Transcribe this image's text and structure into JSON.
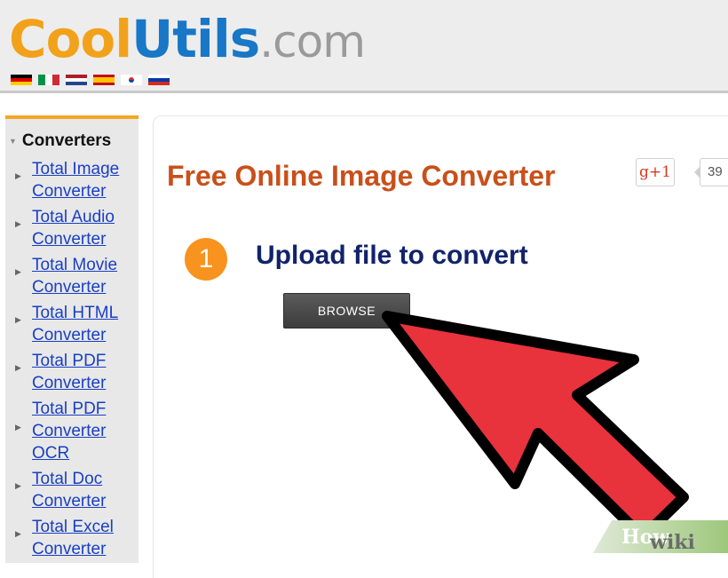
{
  "header": {
    "logo": {
      "part1": "Cool",
      "part2": "Utils",
      "part3": ".com"
    },
    "flags": [
      "german-flag",
      "italian-flag",
      "dutch-flag",
      "spanish-flag",
      "korean-flag",
      "russian-flag"
    ]
  },
  "sidebar": {
    "title": "Converters",
    "items": [
      {
        "label": "Total Image Converter"
      },
      {
        "label": "Total Audio Converter"
      },
      {
        "label": "Total Movie Converter"
      },
      {
        "label": "Total HTML Converter"
      },
      {
        "label": "Total PDF Converter"
      },
      {
        "label": "Total PDF Converter OCR"
      },
      {
        "label": "Total Doc Converter"
      },
      {
        "label": "Total Excel Converter"
      }
    ]
  },
  "main": {
    "title": "Free Online Image Converter",
    "gplus_label": "g+1",
    "gplus_count": "39",
    "step": {
      "number": "1",
      "label": "Upload file to convert"
    },
    "browse_label": "BROWSE"
  },
  "badge": {
    "part1": "wiki",
    "part2": "How"
  },
  "colors": {
    "accent_orange": "#f7931e",
    "title": "#c8501a",
    "step_label": "#12236b",
    "cursor_red": "#e8323c",
    "link": "#1a3fc4"
  }
}
